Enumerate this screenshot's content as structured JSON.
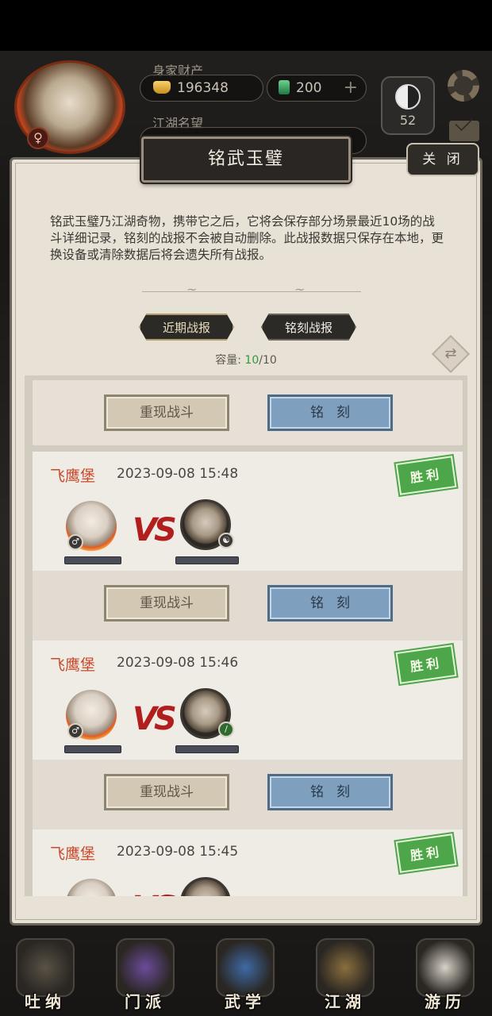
{
  "hud": {
    "wealth_label": "身家财产",
    "coins": "196348",
    "jade": "200",
    "fame_label": "江湖名望",
    "level": "52",
    "plus": "+"
  },
  "modal": {
    "title": "铭武玉璧",
    "close_label": "关 闭",
    "description": "铭武玉璧乃江湖奇物，携带它之后，它将会保存部分场景最近10场的战斗详细记录，铭刻的战报不会被自动删除。此战报数据只保存在本地，更换设备或清除数据后将会遗失所有战报。",
    "tabs": [
      {
        "label": "近期战报",
        "active": true
      },
      {
        "label": "铭刻战报",
        "active": false
      }
    ],
    "capacity_label": "容量:",
    "capacity_used": "10",
    "capacity_total": "/10",
    "switch_icon": "⇄"
  },
  "actions": {
    "replay_label": "重现战斗",
    "engrave_label": "铭刻"
  },
  "records": [
    {
      "location": "飞鹰堡",
      "time": "2023-09-08 15:48",
      "result": "胜利",
      "vs": "VS"
    },
    {
      "location": "飞鹰堡",
      "time": "2023-09-08 15:46",
      "result": "胜利",
      "vs": "VS"
    },
    {
      "location": "飞鹰堡",
      "time": "2023-09-08 15:45",
      "result": "胜利",
      "vs": "VS"
    }
  ],
  "nav": [
    {
      "label": "吐纳",
      "icon": "meditation-icon"
    },
    {
      "label": "门派",
      "icon": "sect-flag-icon"
    },
    {
      "label": "武学",
      "icon": "martial-book-icon"
    },
    {
      "label": "江湖",
      "icon": "bamboo-hat-icon"
    },
    {
      "label": "游历",
      "icon": "horse-icon"
    }
  ],
  "colors": {
    "accent_red": "#c7492a",
    "win_green": "#4da64a",
    "engrave_blue": "#7e9fbd"
  }
}
